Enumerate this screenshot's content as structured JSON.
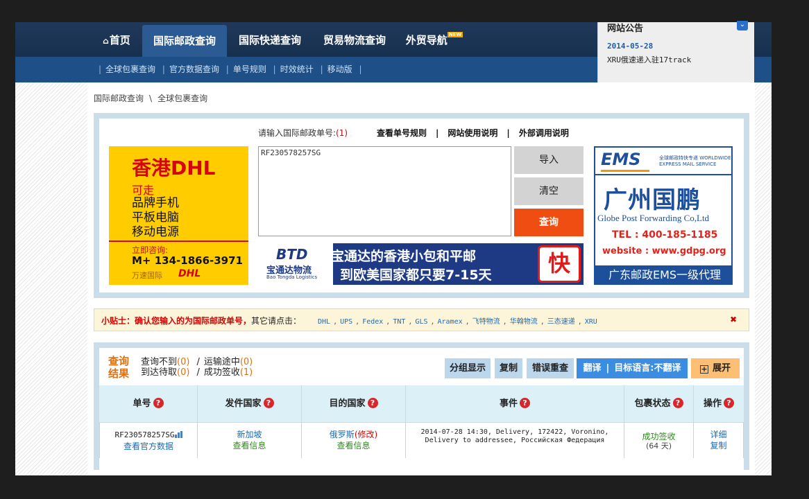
{
  "nav": {
    "items": [
      {
        "label": "首页"
      },
      {
        "label": "国际邮政查询"
      },
      {
        "label": "国际快递查询"
      },
      {
        "label": "贸易物流查询"
      },
      {
        "label": "外贸导航"
      }
    ],
    "new_badge": "NEW"
  },
  "subnav": {
    "items": [
      "全球包裹查询",
      "官方数据查询",
      "单号规则",
      "时效统计",
      "移动版"
    ]
  },
  "notice": {
    "title": "网站公告",
    "date": "2014-05-28",
    "text": "XRU俄速递入驻17track"
  },
  "breadcrumb": {
    "root": "国际邮政查询",
    "current": "全球包裹查询"
  },
  "search": {
    "label": "请输入国际邮政单号:",
    "count": "(1)",
    "links": [
      "查看单号规则",
      "网站使用说明",
      "外部调用说明"
    ],
    "value": "RF230578257SG",
    "import_label": "导入",
    "clear_label": "清空",
    "query_label": "查询"
  },
  "ads": {
    "dhl": {
      "title": "香港DHL",
      "subtitle": "可走",
      "lines": [
        "品牌手机",
        "平板电脑",
        "移动电源"
      ],
      "consult": "立即咨询:",
      "phone": "M+ 134-1866-3971",
      "company": "万速国际",
      "brand": "DHL"
    },
    "btd": {
      "logo": "BTD",
      "name": "宝通达物流",
      "name_en": "Bao Tongda Logistics",
      "slogan1": "宝通达的香港小包和平邮",
      "slogan2": "到欧美国家都只要7-15天",
      "badge": "快"
    },
    "ems": {
      "logo": "EMS",
      "logo_sub": "全球邮政特快专递 WORLDWIDE EXPRESS MAIL SERVICE",
      "name": "广州国鹏",
      "name_en": "Globe Post Forwarding Co,Ltd",
      "tel": "TEL : 400-185-1185",
      "web": "website : www.gdpg.org",
      "footer": "广东邮政EMS一级代理"
    }
  },
  "tip": {
    "label": "小贴士：确认您输入的为国际邮政单号，",
    "prompt": "其它请点击：",
    "links": [
      "DHL",
      "UPS",
      "Fedex",
      "TNT",
      "GLS",
      "Aramex",
      "飞特物流",
      "华翰物流",
      "三态速递",
      "XRU"
    ],
    "close": "✖"
  },
  "result": {
    "title": "查询结果",
    "stats": {
      "not_found_label": "查询不到",
      "not_found": "(0)",
      "in_transit_label": "运输途中",
      "in_transit": "(0)",
      "pickup_label": "到达待取",
      "pickup": "(0)",
      "delivered_label": "成功签收",
      "delivered": "(1)"
    },
    "buttons": {
      "group": "分组显示",
      "copy": "复制",
      "recheck": "错误重查",
      "translate": "翻译",
      "target_lang": "目标语言:不翻译",
      "expand": "展开"
    },
    "columns": [
      "单号",
      "发件国家",
      "目的国家",
      "事件",
      "包裹状态",
      "操作"
    ],
    "rows": [
      {
        "number": "RF230578257SG",
        "official": "查看官方数据",
        "origin": "新加坡",
        "origin_info": "查看信息",
        "dest": "俄罗斯",
        "dest_edit": "(修改)",
        "dest_info": "查看信息",
        "event": "2014-07-28 14:30, Delivery, 172422, Voronino, Delivery to addressee, Российская Федерация",
        "status": "成功签收",
        "days": "(64 天)",
        "detail": "详细",
        "copy": "复制"
      }
    ]
  }
}
